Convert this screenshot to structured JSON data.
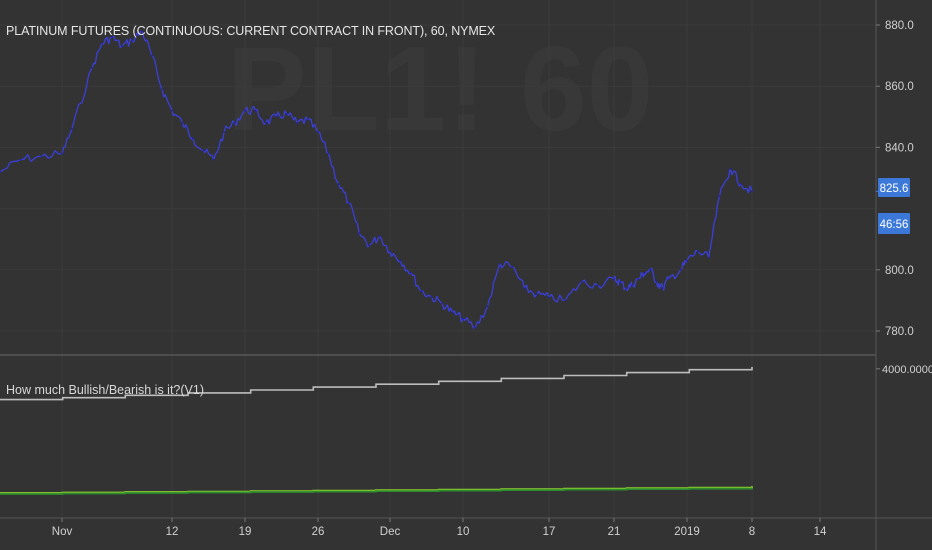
{
  "chart_data": [
    {
      "type": "line",
      "title": "PLATINUM FUTURES (CONTINUOUS: CURRENT CONTRACT IN FRONT), 60, NYMEX",
      "x_ticks": [
        "Nov",
        "12",
        "19",
        "26",
        "Dec",
        "10",
        "17",
        "21",
        "2019",
        "8",
        "14"
      ],
      "y_ticks": [
        "880.0",
        "860.0",
        "840.0",
        "800.0",
        "780.0"
      ],
      "ylim": [
        776,
        886
      ],
      "series": [
        {
          "color": "#3a3fd9",
          "x": [
            "Oct 26",
            "Oct 28",
            "Oct 30",
            "Nov 1",
            "Nov 2",
            "Nov 4",
            "Nov 5",
            "Nov 6",
            "Nov 7",
            "Nov 8",
            "Nov 9",
            "Nov 10",
            "Nov 11",
            "Nov 12",
            "Nov 13",
            "Nov 14",
            "Nov 15",
            "Nov 16",
            "Nov 17",
            "Nov 18",
            "Nov 19",
            "Nov 20",
            "Nov 21",
            "Nov 22",
            "Nov 23",
            "Nov 24",
            "Nov 25",
            "Nov 26",
            "Nov 27",
            "Nov 28",
            "Nov 29",
            "Nov 30",
            "Dec 1",
            "Dec 2",
            "Dec 3",
            "Dec 4",
            "Dec 5",
            "Dec 6",
            "Dec 7",
            "Dec 8",
            "Dec 9",
            "Dec 10",
            "Dec 11",
            "Dec 12",
            "Dec 13",
            "Dec 14",
            "Dec 15",
            "Dec 16",
            "Dec 17",
            "Dec 18",
            "Dec 19",
            "Dec 20",
            "Dec 21",
            "Dec 22",
            "Dec 23",
            "Dec 24",
            "Dec 25",
            "Dec 26",
            "Dec 27",
            "Dec 28",
            "Dec 29",
            "Dec 30",
            "Jan 1",
            "Jan 2",
            "Jan 3",
            "Jan 4",
            "Jan 5",
            "Jan 6",
            "Jan 7",
            "Jan 8"
          ],
          "values": [
            832,
            836,
            837,
            838,
            846,
            866,
            874,
            876,
            873,
            875,
            878,
            870,
            859,
            852,
            848,
            843,
            839,
            836,
            845,
            848,
            852,
            852,
            848,
            850,
            851,
            848,
            849,
            845,
            838,
            828,
            822,
            812,
            808,
            811,
            806,
            803,
            799,
            793,
            791,
            789,
            786,
            784,
            781,
            788,
            802,
            801,
            794,
            792,
            791,
            790,
            796,
            795,
            797,
            796,
            794,
            795,
            797,
            799,
            800,
            796,
            794,
            797,
            800,
            803,
            806,
            804,
            824,
            833,
            828,
            825.6
          ]
        }
      ],
      "last_price": "825.6",
      "countdown": "46:56"
    },
    {
      "type": "line",
      "title": "How much Bullish/Bearish is it?(V1)",
      "y_ticks": [
        "4000.0000"
      ],
      "series": [
        {
          "color": "#bdbdbd",
          "values": [
            3360,
            3400,
            3450,
            3500,
            3560,
            3620,
            3680,
            3740,
            3800,
            3860,
            3920,
            3980,
            4040
          ]
        },
        {
          "color": "#8fcf2e",
          "values": [
            1420,
            1430,
            1440,
            1450,
            1460,
            1470,
            1480,
            1490,
            1500,
            1510,
            1520,
            1530,
            1560
          ]
        },
        {
          "color": "#2e8b2e",
          "values": [
            1400,
            1410,
            1420,
            1430,
            1440,
            1450,
            1460,
            1470,
            1480,
            1490,
            1500,
            1510,
            1530
          ]
        }
      ]
    }
  ],
  "watermark": "PL1! 60",
  "colors": {
    "background": "#333333",
    "price_line": "#3a3fd9",
    "price_badge": "#3b78d8",
    "grid": "#3b3b3b",
    "axis_text": "#d0d0d0"
  }
}
